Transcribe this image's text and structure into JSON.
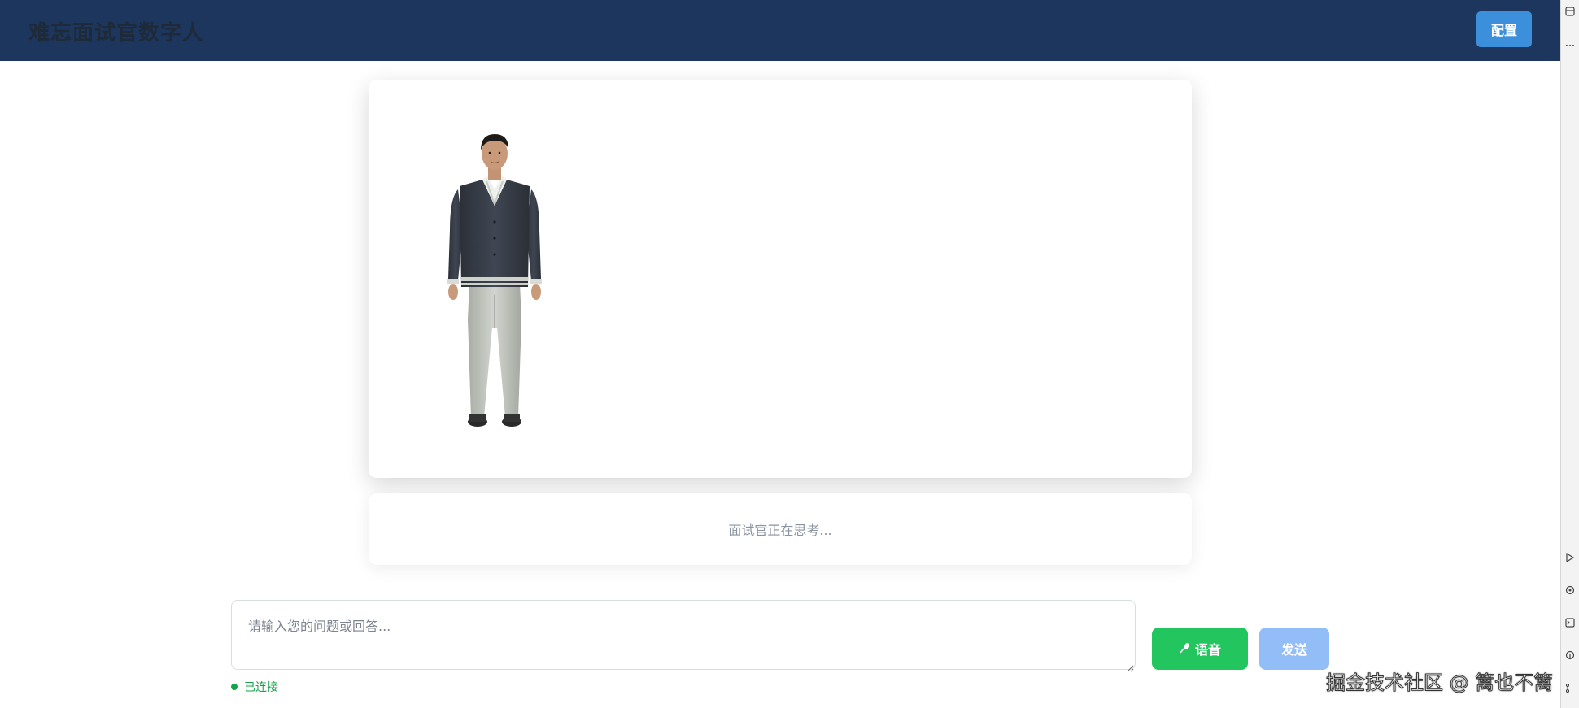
{
  "header": {
    "title": "难忘面试官数字人",
    "config_label": "配置",
    "background_color": "#1c365d",
    "config_button_color": "#3b8fdb"
  },
  "avatar": {
    "icon": "digital-human-avatar"
  },
  "status": {
    "text": "面试官正在思考..."
  },
  "input": {
    "placeholder": "请输入您的问题或回答...",
    "value": ""
  },
  "buttons": {
    "voice_icon": "microphone-icon",
    "voice_label": "语音",
    "voice_color": "#22c55e",
    "send_label": "发送",
    "send_color": "#93bdf6"
  },
  "connection": {
    "text": "已连接",
    "color": "#16a34a"
  },
  "watermark": {
    "text": "掘金技术社区 @ 篱也不篱"
  }
}
